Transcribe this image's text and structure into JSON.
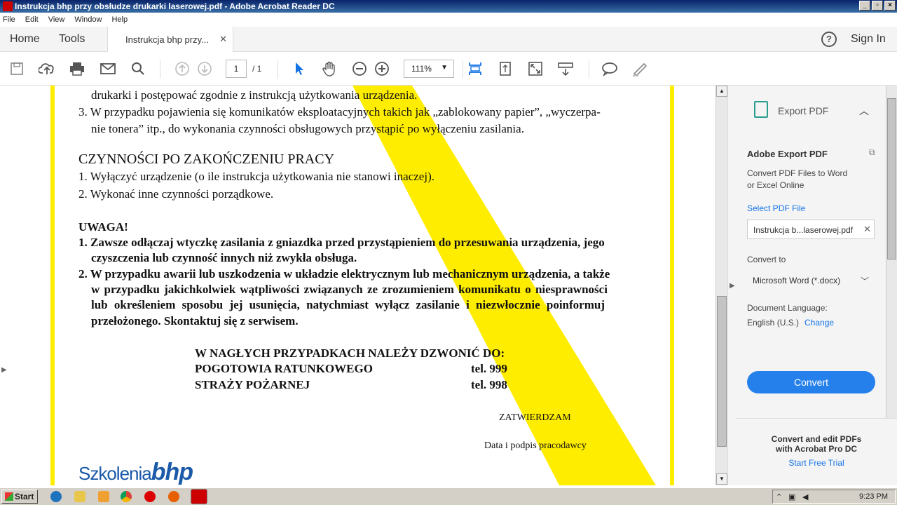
{
  "window": {
    "title": "Instrukcja bhp przy obsłudze drukarki laserowej.pdf - Adobe Acrobat Reader DC"
  },
  "menu": [
    "File",
    "Edit",
    "View",
    "Window",
    "Help"
  ],
  "nav": {
    "home": "Home",
    "tools": "Tools",
    "doc_tab": "Instrukcja bhp przy...",
    "sign_in": "Sign In"
  },
  "toolbar": {
    "page_current": "1",
    "page_total": "/ 1",
    "zoom": "111%"
  },
  "document": {
    "lines": [
      "drukarki i postępować zgodnie z instrukcją użytkowania urządzenia.",
      "3. W przypadku pojawienia się komunikatów eksploatacyjnych takich jak „zablokowany papier”, „wyczerpa-",
      "nie tonera” itp., do wykonania czynności obsługowych przystąpić po wyłączeniu zasilania.",
      "CZYNNOŚCI PO ZAKOŃCZENIU PRACY",
      "1. Wyłączyć urządzenie (o ile instrukcja użytkowania nie stanowi inaczej).",
      "2. Wykonać inne czynności porządkowe.",
      "UWAGA!",
      "1. Zawsze odłączaj wtyczkę zasilania z gniazdka przed przystąpieniem do przesuwania urządzenia, jego",
      "czyszczenia lub czynność innych niż zwykła obsługa.",
      "2. W przypadku awarii lub uszkodzenia w układzie elektrycznym lub mechanicznym urządzenia, a także",
      "w przypadku jakichkolwiek wątpliwości związanych ze zrozumieniem komunikatu o niesprawności",
      "lub określeniem sposobu jej usunięcia, natychmiast wyłącz zasilanie i niezwłocznie poinformuj",
      "przełożonego. Skontaktuj się z serwisem.",
      "W NAGŁYCH PRZYPADKACH NALEŻY DZWONIĆ DO:",
      "POGOTOWIA RATUNKOWEGO",
      "tel.   999",
      "STRAŻY POŻARNEJ",
      "tel.   998",
      "ZATWIERDZAM",
      "Data i podpis pracodawcy"
    ],
    "logo": "Szkolenia bhp"
  },
  "right_pane": {
    "header": "Export PDF",
    "title": "Adobe Export PDF",
    "desc_line1": "Convert PDF Files to Word",
    "desc_line2": "or Excel Online",
    "select_link": "Select PDF File",
    "file_name": "Instrukcja b...laserowej.pdf",
    "convert_to_label": "Convert to",
    "convert_to_value": "Microsoft Word (*.docx)",
    "doc_lang_label": "Document Language:",
    "doc_lang_value": "English (U.S.)",
    "change_link": "Change",
    "convert_button": "Convert",
    "promo_line1": "Convert and edit PDFs",
    "promo_line2": "with Acrobat Pro DC",
    "promo_link": "Start Free Trial",
    "accent": "#2680eb"
  },
  "taskbar": {
    "start": "Start",
    "clock": "9:23 PM"
  }
}
